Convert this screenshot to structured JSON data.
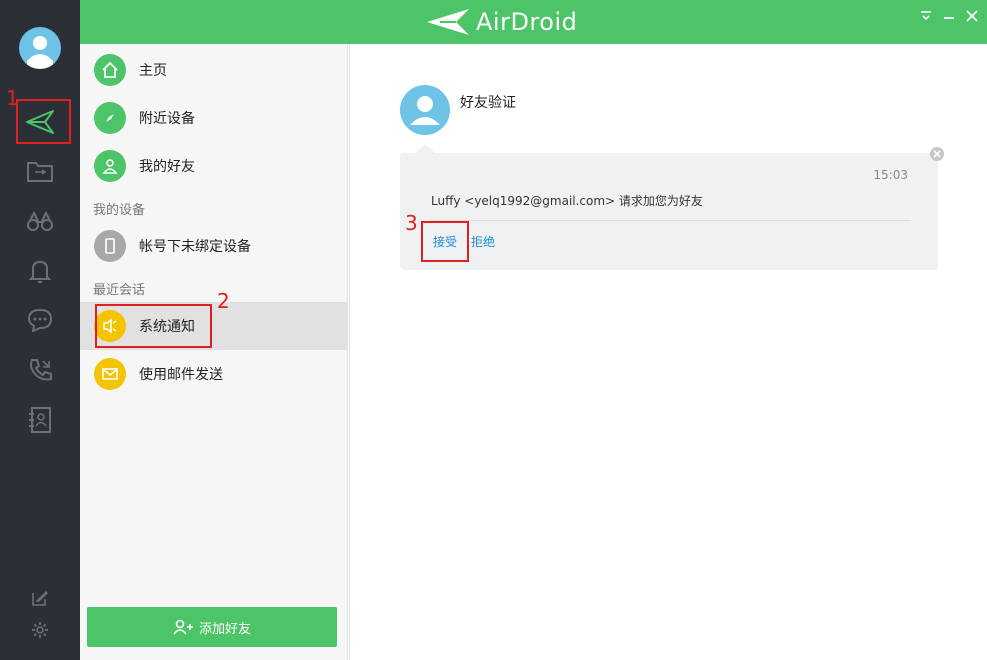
{
  "app": {
    "name": "AirDroid"
  },
  "colors": {
    "brand": "#4cc467",
    "rail": "#2b2f36",
    "link": "#1a8fd6",
    "annotation": "#e02020",
    "avatar": "#6ec3e6",
    "warn": "#f5c400"
  },
  "rail": {
    "items": [
      {
        "icon": "transfer-plane-icon",
        "active": true
      },
      {
        "icon": "file-transfer-icon"
      },
      {
        "icon": "find-phone-binoculars-icon"
      },
      {
        "icon": "notification-bell-icon"
      },
      {
        "icon": "message-icon"
      },
      {
        "icon": "call-icon"
      },
      {
        "icon": "contacts-icon"
      }
    ],
    "bottom": [
      {
        "icon": "edit-icon"
      },
      {
        "icon": "settings-icon"
      }
    ]
  },
  "window_controls": [
    "menu-icon",
    "minimize-icon",
    "close-icon"
  ],
  "sidebar": {
    "items": [
      {
        "label": "主页",
        "icon": "home-icon"
      },
      {
        "label": "附近设备",
        "icon": "compass-icon"
      },
      {
        "label": "我的好友",
        "icon": "friends-icon"
      }
    ],
    "my_devices_header": "我的设备",
    "devices": [
      {
        "label": "帐号下未绑定设备",
        "icon": "phone-device-icon"
      }
    ],
    "recent_header": "最近会话",
    "recent": [
      {
        "label": "系统通知",
        "icon": "speaker-icon",
        "selected": true
      },
      {
        "label": "使用邮件发送",
        "icon": "mail-icon"
      }
    ],
    "add_friend": "添加好友"
  },
  "annotations": [
    "1",
    "2",
    "3"
  ],
  "main": {
    "title": "好友验证",
    "message": {
      "time": "15:03",
      "text": "Luffy <yelq1992@gmail.com> 请求加您为好友",
      "accept": "接受",
      "reject": "拒绝"
    }
  }
}
